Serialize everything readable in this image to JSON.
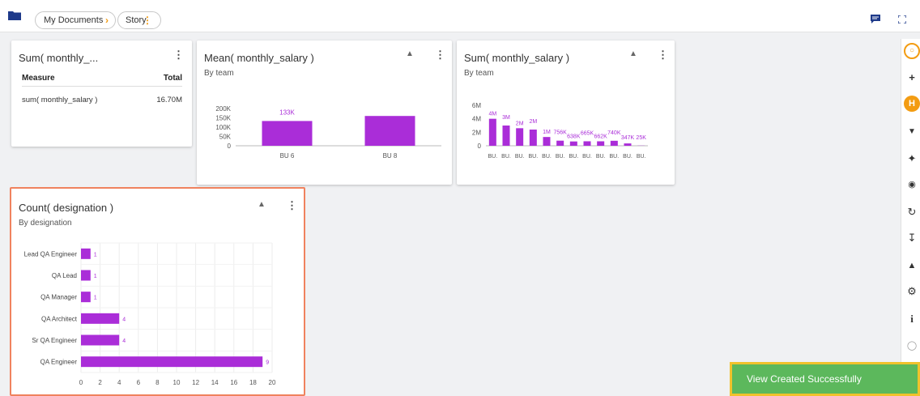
{
  "breadcrumb": {
    "folder": "My Documents",
    "story": "Story"
  },
  "icons": {
    "folder": "folder-icon",
    "chevron": "chevron-right-icon",
    "kebab": "kebab-icon",
    "comment": "comment-icon",
    "expand": "expand-icon"
  },
  "colors": {
    "accent": "#f39c12",
    "bar": "#aa2dd8",
    "toast": "#5cb85c",
    "highlight": "#f0825e"
  },
  "card1": {
    "title": "Sum( monthly_...",
    "header": {
      "measure": "Measure",
      "total": "Total"
    },
    "row": {
      "measure": "sum( monthly_salary )",
      "total": "16.70M"
    }
  },
  "card2": {
    "title": "Mean( monthly_salary )",
    "subtitle": "By team"
  },
  "card3": {
    "title": "Sum( monthly_salary )",
    "subtitle": "By team"
  },
  "card4": {
    "title": "Count( designation )",
    "subtitle": "By designation"
  },
  "chart_data": [
    {
      "type": "bar",
      "title": "Mean( monthly_salary )",
      "subtitle": "By team",
      "categories": [
        "BU 6",
        "BU 8"
      ],
      "values": [
        133000,
        160000
      ],
      "data_labels": [
        "133K",
        ""
      ],
      "yticks": [
        "200K",
        "150K",
        "100K",
        "50K",
        "0"
      ],
      "ylim": [
        0,
        200000
      ],
      "grid": false
    },
    {
      "type": "bar",
      "title": "Sum( monthly_salary )",
      "subtitle": "By team",
      "categories": [
        "BU.",
        "BU.",
        "BU.",
        "BU.",
        "BU.",
        "BU.",
        "BU.",
        "BU.",
        "BU.",
        "BU.",
        "BU.",
        "BU."
      ],
      "values": [
        4000000,
        3000000,
        2600000,
        2400000,
        1300000,
        756000,
        638000,
        665000,
        662000,
        740000,
        347000,
        25000
      ],
      "data_labels": [
        "4M",
        "3M",
        "2M",
        "2M",
        "1M",
        "756K",
        "638K",
        "665K",
        "662K",
        "740K",
        "347K",
        "25K"
      ],
      "yticks": [
        "6M",
        "4M",
        "2M",
        "0"
      ],
      "ylim": [
        0,
        6000000
      ],
      "grid": false
    },
    {
      "type": "bar",
      "orientation": "horizontal",
      "title": "Count( designation )",
      "subtitle": "By designation",
      "categories": [
        "Lead QA Engineer",
        "QA Lead",
        "QA Manager",
        "QA Architect",
        "Sr QA Engineer",
        "QA Engineer"
      ],
      "values": [
        1,
        1,
        1,
        4,
        4,
        19
      ],
      "data_labels": [
        "1",
        "1",
        "1",
        "4",
        "4",
        "9"
      ],
      "xticks": [
        "0",
        "2",
        "4",
        "6",
        "8",
        "10",
        "12",
        "14",
        "16",
        "18",
        "20"
      ],
      "xlim": [
        0,
        20
      ],
      "grid": true
    }
  ],
  "right_rail": [
    "search-icon",
    "plus-icon",
    "h-icon",
    "filter-icon",
    "share-icon",
    "eye-icon",
    "refresh-icon",
    "download-icon",
    "bell-icon",
    "gear-icon",
    "info-icon",
    "bulb-icon"
  ],
  "toast": {
    "message": "View Created Successfully"
  }
}
